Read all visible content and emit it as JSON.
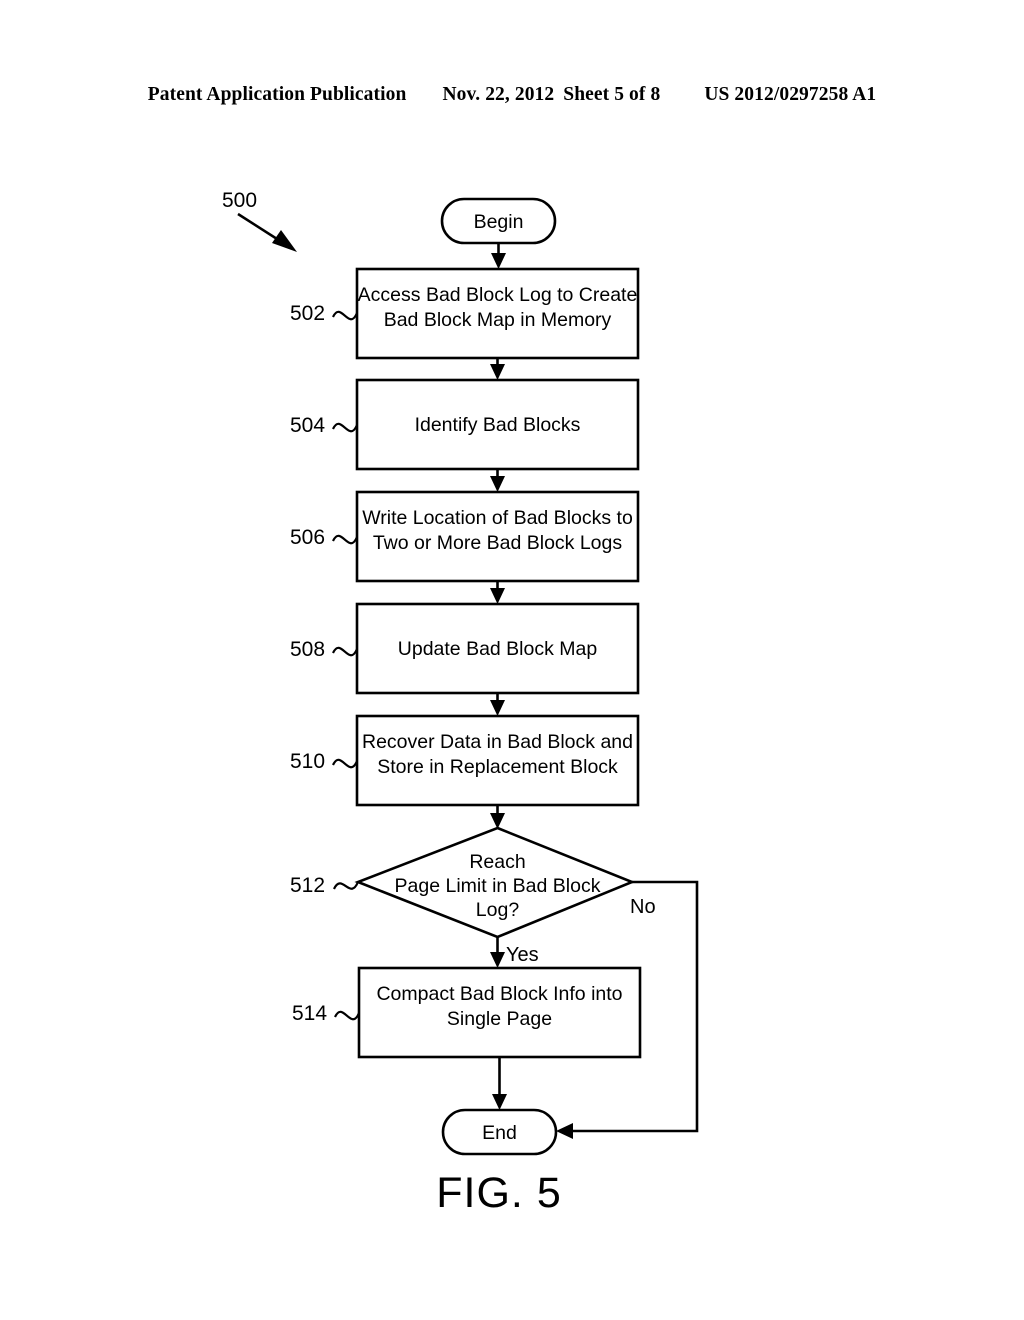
{
  "header": {
    "publication": "Patent Application Publication",
    "date": "Nov. 22, 2012",
    "sheet": "Sheet 5 of 8",
    "patent_number": "US 2012/0297258 A1"
  },
  "figure": {
    "caption": "FIG. 5",
    "diagram_ref": "500",
    "terminals": {
      "begin": "Begin",
      "end": "End"
    },
    "branch_labels": {
      "yes": "Yes",
      "no": "No"
    },
    "steps": [
      {
        "ref": "502",
        "text_lines": [
          "Access Bad Block Log to Create",
          "Bad Block Map in Memory"
        ]
      },
      {
        "ref": "504",
        "text_lines": [
          "Identify Bad Blocks"
        ]
      },
      {
        "ref": "506",
        "text_lines": [
          "Write Location of Bad Blocks to",
          "Two or More Bad Block Logs"
        ]
      },
      {
        "ref": "508",
        "text_lines": [
          "Update Bad Block Map"
        ]
      },
      {
        "ref": "510",
        "text_lines": [
          "Recover Data in Bad Block and",
          "Store in Replacement Block"
        ]
      },
      {
        "ref": "514",
        "text_lines": [
          "Compact Bad Block Info into",
          "Single Page"
        ]
      }
    ],
    "decision": {
      "ref": "512",
      "text_lines": [
        "Reach",
        "Page Limit in Bad Block",
        "Log?"
      ]
    }
  },
  "colors": {
    "ink": "#000000",
    "paper": "#ffffff"
  }
}
